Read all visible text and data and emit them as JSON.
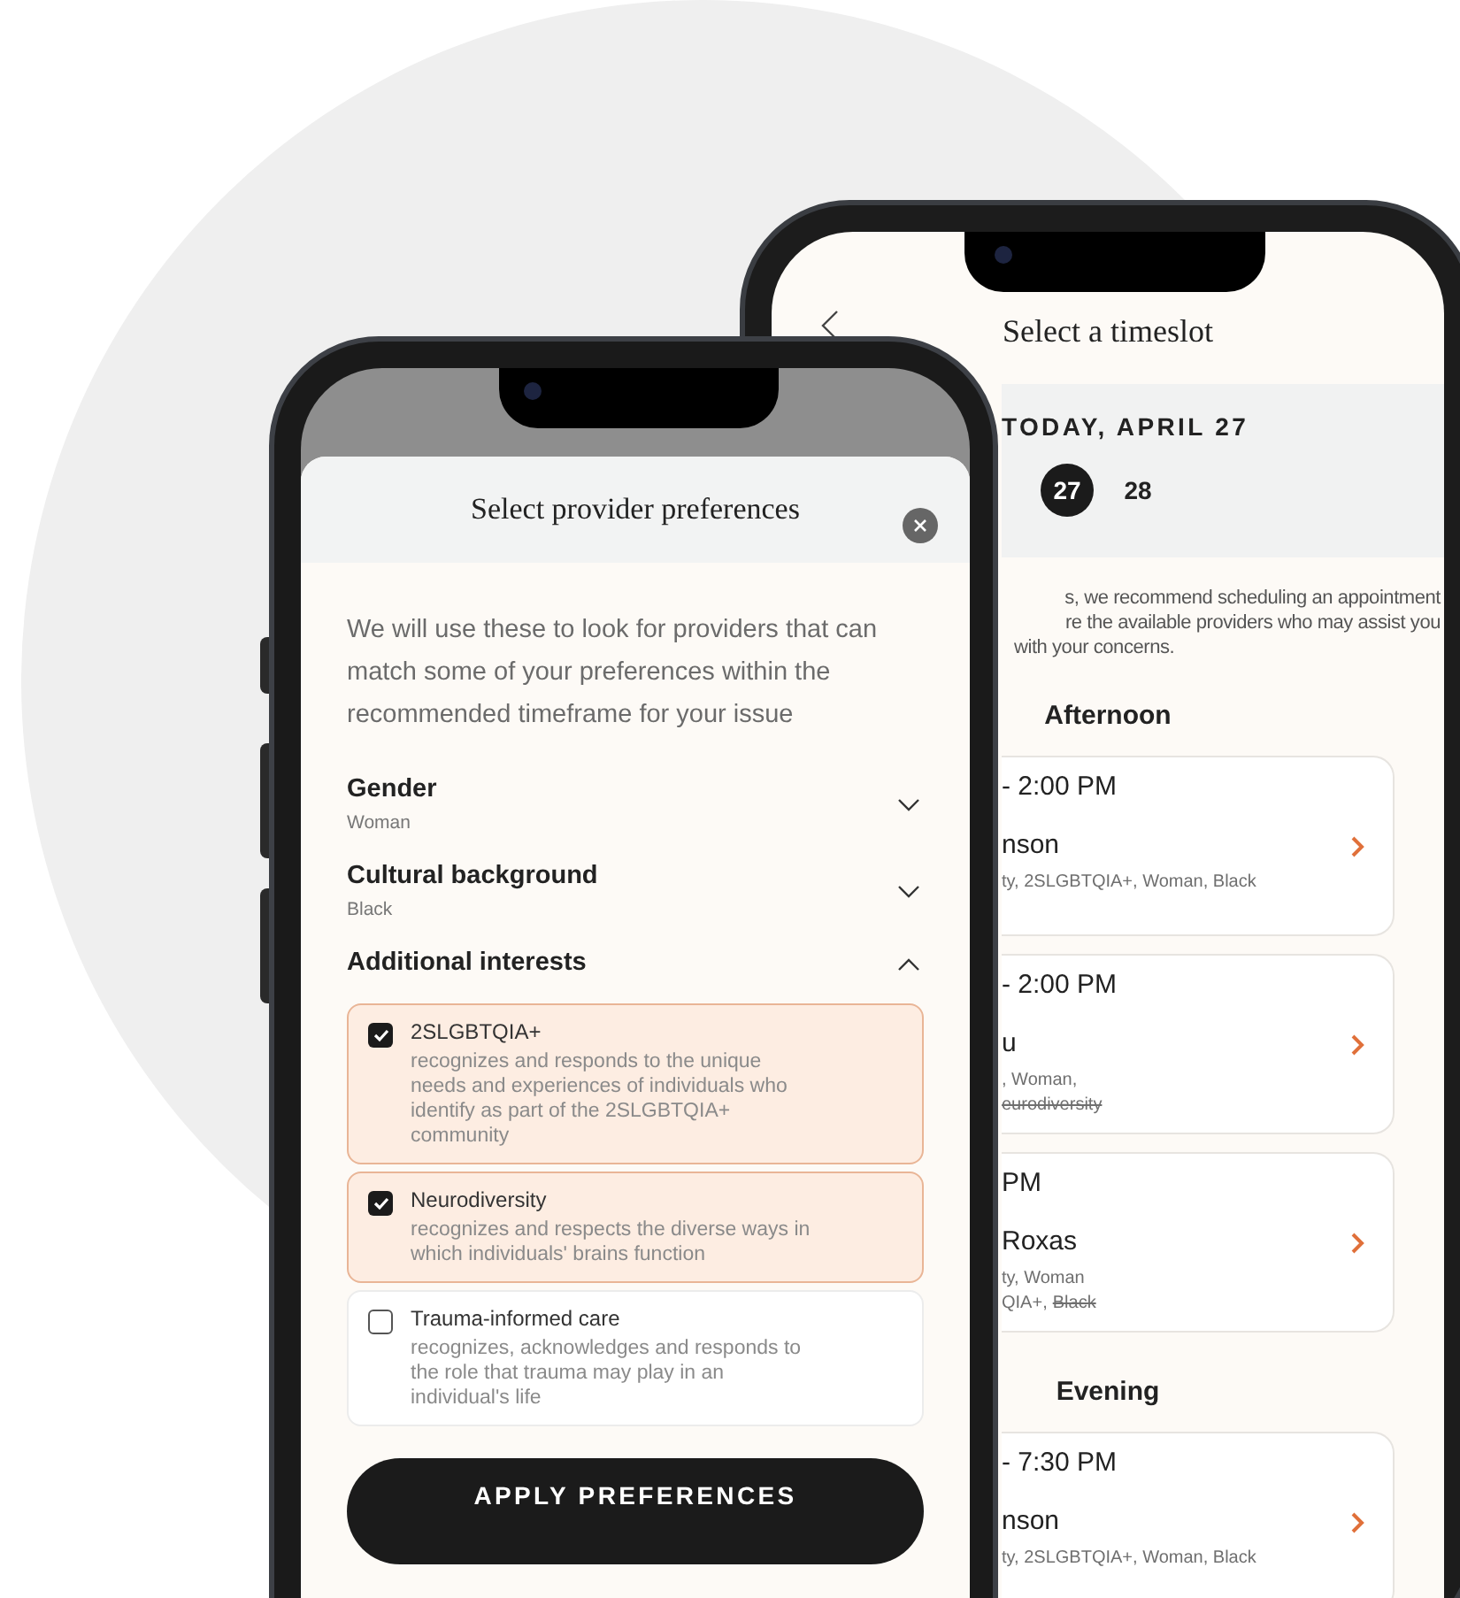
{
  "timeslot_screen": {
    "title": "Select a timeslot",
    "date_heading": "TODAY, APRIL 27",
    "dates": [
      {
        "label": "27",
        "selected": true
      },
      {
        "label": "28",
        "selected": false
      }
    ],
    "recommendation_lines": [
      "s, we recommend scheduling an appointment",
      "re the available providers who may assist you",
      "with your concerns."
    ],
    "sections": [
      {
        "heading": "Afternoon",
        "slots": [
          {
            "time": "- 2:00 PM",
            "provider": "nson",
            "tag_lines": [
              [
                {
                  "text": "ty, 2SLGBTQIA+, Woman, Black",
                  "struck": false
                }
              ]
            ]
          },
          {
            "time": "- 2:00 PM",
            "provider": "u",
            "tag_lines": [
              [
                {
                  "text": ", Woman,",
                  "struck": false
                }
              ],
              [
                {
                  "text": "eurodiversity",
                  "struck": true
                }
              ]
            ]
          },
          {
            "time": "PM",
            "provider": "Roxas",
            "tag_lines": [
              [
                {
                  "text": "ty, Woman",
                  "struck": false
                }
              ],
              [
                {
                  "text": "QIA+,",
                  "struck": false
                },
                {
                  "text": "Black",
                  "struck": true
                }
              ]
            ]
          }
        ]
      },
      {
        "heading": "Evening",
        "slots": [
          {
            "time": "- 7:30 PM",
            "provider": "nson",
            "tag_lines": [
              [
                {
                  "text": "ty, 2SLGBTQIA+, Woman, Black",
                  "struck": false
                }
              ]
            ]
          }
        ]
      }
    ]
  },
  "preferences_sheet": {
    "title": "Select provider preferences",
    "intro": "We will use these to look for providers that can match some of your preferences within the recommended timeframe for your issue",
    "filters": [
      {
        "label": "Gender",
        "value": "Woman",
        "expanded": false
      },
      {
        "label": "Cultural background",
        "value": "Black",
        "expanded": false
      },
      {
        "label": "Additional interests",
        "expanded": true,
        "options": [
          {
            "title": "2SLGBTQIA+",
            "description": "recognizes and responds to the unique needs and experiences of individuals who identify as part of the 2SLGBTQIA+ community",
            "checked": true
          },
          {
            "title": "Neurodiversity",
            "description": "recognizes and respects the diverse ways in which individuals' brains function",
            "checked": true
          },
          {
            "title": "Trauma-informed care",
            "description": "recognizes, acknowledges and responds to the role that trauma may play in an individual's life",
            "checked": false
          }
        ]
      }
    ],
    "apply_button": "APPLY PREFERENCES"
  }
}
